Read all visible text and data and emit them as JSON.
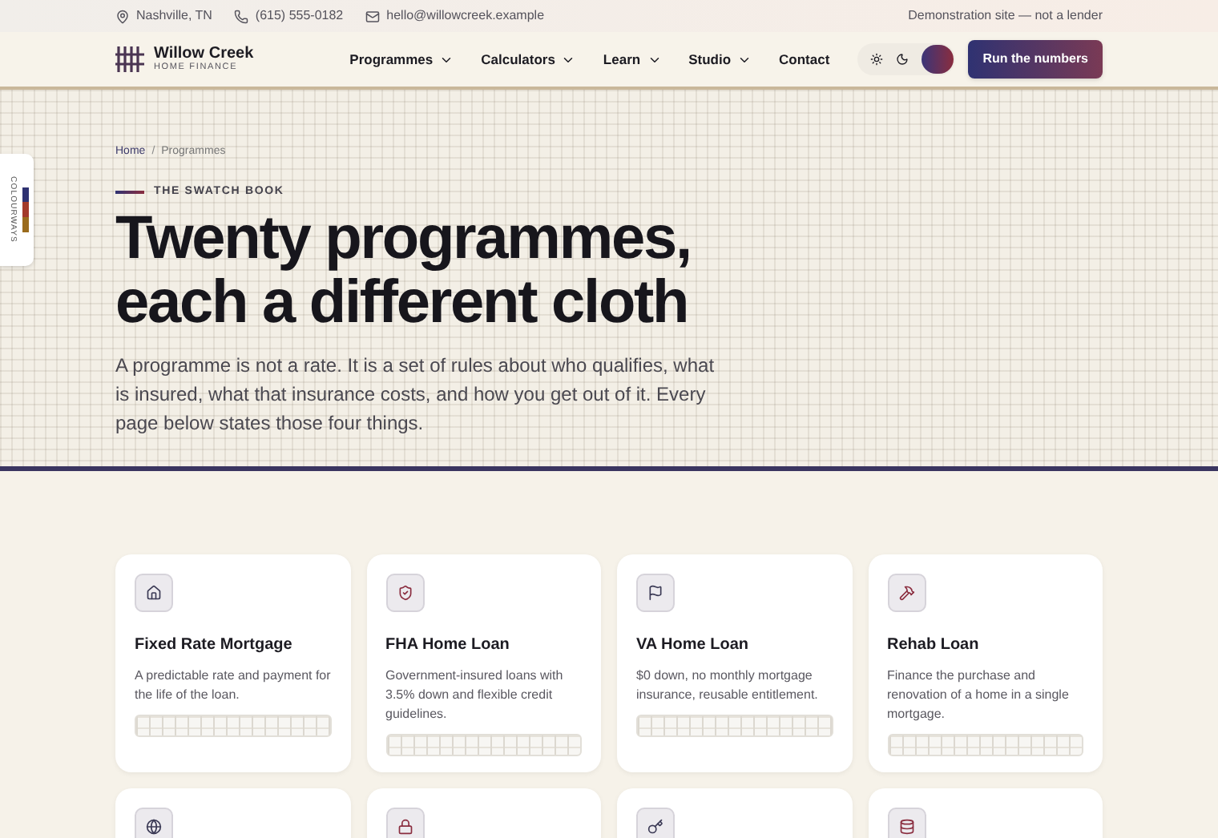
{
  "top_bar": {
    "location": "Nashville, TN",
    "phone": "(615) 555-0182",
    "email": "hello@willowcreek.example",
    "notice": "Demonstration site — not a lender"
  },
  "brand": {
    "name": "Willow Creek",
    "tagline": "HOME FINANCE"
  },
  "nav": [
    {
      "label": "Programmes",
      "has_menu": true
    },
    {
      "label": "Calculators",
      "has_menu": true
    },
    {
      "label": "Learn",
      "has_menu": true
    },
    {
      "label": "Studio",
      "has_menu": true
    },
    {
      "label": "Contact",
      "has_menu": false
    }
  ],
  "cta": "Run the numbers",
  "side_tab": {
    "label": "COLOURWAYS"
  },
  "breadcrumb": [
    "Home",
    "/",
    "Programmes"
  ],
  "eyebrow": "THE SWATCH BOOK",
  "heading": "Twenty programmes, each a different cloth",
  "intro": "A programme is not a rate. It is a set of rules about who qualifies, what is insured, what that insurance costs, and how you get out of it. Every page below states those four things.",
  "cards": [
    {
      "kind": "full",
      "title": "Fixed Rate Mortgage",
      "text": "A predictable rate and payment for the life of the loan."
    },
    {
      "kind": "full",
      "title": "FHA Home Loan",
      "text": "Government-insured loans with 3.5% down and flexible credit guidelines."
    },
    {
      "kind": "full",
      "title": "VA Home Loan",
      "text": "$0 down, no monthly mortgage insurance, reusable entitlement."
    },
    {
      "kind": "full",
      "title": "Rehab Loan",
      "text": "Finance the purchase and renovation of a home in a single mortgage."
    },
    {
      "kind": "cut"
    },
    {
      "kind": "cut"
    },
    {
      "kind": "cut"
    },
    {
      "kind": "cut"
    }
  ]
}
